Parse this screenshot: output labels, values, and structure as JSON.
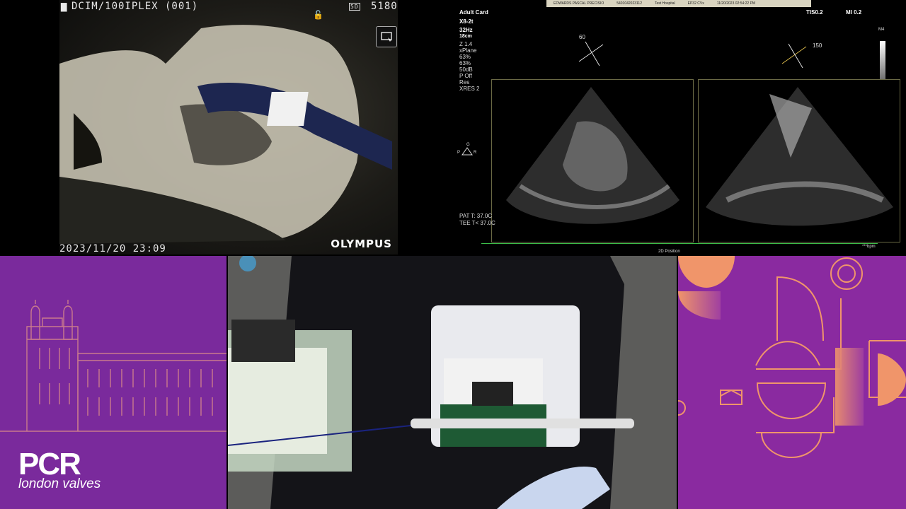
{
  "endoscope": {
    "folder": "DCIM/100IPLEX (001)",
    "top_right_code": "5180",
    "badge": "5D",
    "timestamp": "2023/11/20 23:09",
    "brand": "OLYMPUS",
    "icons": [
      "folder-icon",
      "lock-icon",
      "capture-icon"
    ]
  },
  "echo": {
    "topbar": [
      "EDWARDS PASCAL PRECISIO",
      "5401042023112",
      "Test Hospital",
      "EP32 CVx",
      "11/20/2023 02:54:22 PM"
    ],
    "preset": "Adult Card",
    "probe": "X8-2t",
    "frame_rate": "32Hz",
    "depth": "18cm",
    "params": [
      "Z 1.4",
      "xPlane",
      "63%",
      "63%",
      "50dB",
      "P Off",
      "Res",
      "XRES 2"
    ],
    "tis": "TIS0.2",
    "mi": "MI 0.2",
    "angle_left": "60",
    "angle_right": "150",
    "temp_pat": "PAT T: 37.0C",
    "temp_tee": "TEE T< 37.0C",
    "bpm": "***bpm",
    "bottom_label": "2D Position",
    "scale_label": "M4",
    "orient_top": "G",
    "orient_left": "P",
    "orient_right": "R"
  },
  "branding": {
    "logo": "PCR",
    "subtitle": "london valves"
  },
  "colors": {
    "purple": "#7a2a9c",
    "deco_purple": "#8a2aa0",
    "orange": "#f0956a"
  }
}
